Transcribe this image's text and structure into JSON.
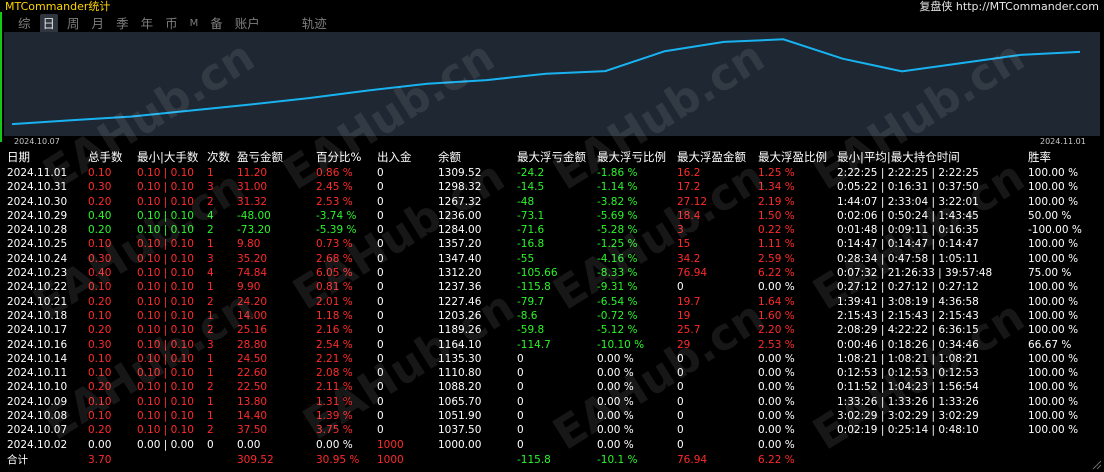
{
  "app": {
    "title": "MTCommander统计",
    "brand": "复盘侠 http://MTCommander.com"
  },
  "tabs": [
    "综",
    "日",
    "周",
    "月",
    "季",
    "年",
    "币",
    "M",
    "备",
    "账户",
    "轨迹"
  ],
  "active_tab": 1,
  "chart": {
    "start_label": "2024.10.07",
    "end_label": "2024.11.01",
    "line_color": "#19b2f0",
    "background": "#1e2732",
    "balance_series": [
      1037.5,
      1051.9,
      1065.7,
      1088.2,
      1110.8,
      1135.3,
      1164.1,
      1189.26,
      1203.26,
      1227.46,
      1237.36,
      1312.2,
      1347.4,
      1357.2,
      1284.0,
      1236.0,
      1267.32,
      1298.32,
      1309.52
    ]
  },
  "table": {
    "headers": [
      "日期",
      "总手数",
      "最小|大手数",
      "次数",
      "盈亏金额",
      "百分比%",
      "出入金",
      "余额",
      "最大浮亏金额",
      "最大浮亏比例",
      "最大浮盈金额",
      "最大浮盈比例",
      "最小|平均|最大持仓时间",
      "胜率"
    ],
    "rows": [
      {
        "date": "2024.11.01",
        "lots": "0.10",
        "minmax": "0.10 | 0.10",
        "count": "1",
        "pnl": "11.20",
        "pct": "0.86 %",
        "flow": "0",
        "balance": "1309.52",
        "max_loss": "-24.2",
        "max_loss_pct": "-1.86 %",
        "max_gain": "16.2",
        "max_gain_pct": "1.25 %",
        "hold": "2:22:25 | 2:22:25 | 2:22:25",
        "win": "100.00 %",
        "c": "red"
      },
      {
        "date": "2024.10.31",
        "lots": "0.30",
        "minmax": "0.10 | 0.10",
        "count": "3",
        "pnl": "31.00",
        "pct": "2.45 %",
        "flow": "0",
        "balance": "1298.32",
        "max_loss": "-14.5",
        "max_loss_pct": "-1.14 %",
        "max_gain": "17.2",
        "max_gain_pct": "1.34 %",
        "hold": "0:05:22 | 0:16:31 | 0:37:50",
        "win": "100.00 %",
        "c": "red"
      },
      {
        "date": "2024.10.30",
        "lots": "0.20",
        "minmax": "0.10 | 0.10",
        "count": "2",
        "pnl": "31.32",
        "pct": "2.53 %",
        "flow": "0",
        "balance": "1267.32",
        "max_loss": "-48",
        "max_loss_pct": "-3.82 %",
        "max_gain": "27.12",
        "max_gain_pct": "2.19 %",
        "hold": "1:44:07 | 2:33:04 | 3:22:01",
        "win": "100.00 %",
        "c": "red"
      },
      {
        "date": "2024.10.29",
        "lots": "0.40",
        "minmax": "0.10 | 0.10",
        "count": "4",
        "pnl": "-48.00",
        "pct": "-3.74 %",
        "flow": "0",
        "balance": "1236.00",
        "max_loss": "-73.1",
        "max_loss_pct": "-5.69 %",
        "max_gain": "18.4",
        "max_gain_pct": "1.50 %",
        "hold": "0:02:06 | 0:50:24 | 1:43:45",
        "win": "50.00 %",
        "c": "green"
      },
      {
        "date": "2024.10.28",
        "lots": "0.20",
        "minmax": "0.10 | 0.10",
        "count": "2",
        "pnl": "-73.20",
        "pct": "-5.39 %",
        "flow": "0",
        "balance": "1284.00",
        "max_loss": "-71.6",
        "max_loss_pct": "-5.28 %",
        "max_gain": "3",
        "max_gain_pct": "0.22 %",
        "hold": "0:01:48 | 0:09:11 | 0:16:35",
        "win": "-100.00 %",
        "c": "green"
      },
      {
        "date": "2024.10.25",
        "lots": "0.10",
        "minmax": "0.10 | 0.10",
        "count": "1",
        "pnl": "9.80",
        "pct": "0.73 %",
        "flow": "0",
        "balance": "1357.20",
        "max_loss": "-16.8",
        "max_loss_pct": "-1.25 %",
        "max_gain": "15",
        "max_gain_pct": "1.11 %",
        "hold": "0:14:47 | 0:14:47 | 0:14:47",
        "win": "100.00 %",
        "c": "red"
      },
      {
        "date": "2024.10.24",
        "lots": "0.30",
        "minmax": "0.10 | 0.10",
        "count": "3",
        "pnl": "35.20",
        "pct": "2.68 %",
        "flow": "0",
        "balance": "1347.40",
        "max_loss": "-55",
        "max_loss_pct": "-4.16 %",
        "max_gain": "34.2",
        "max_gain_pct": "2.59 %",
        "hold": "0:28:34 | 0:47:58 | 1:05:11",
        "win": "100.00 %",
        "c": "red"
      },
      {
        "date": "2024.10.23",
        "lots": "0.40",
        "minmax": "0.10 | 0.10",
        "count": "4",
        "pnl": "74.84",
        "pct": "6.05 %",
        "flow": "0",
        "balance": "1312.20",
        "max_loss": "-105.66",
        "max_loss_pct": "-8.33 %",
        "max_gain": "76.94",
        "max_gain_pct": "6.22 %",
        "hold": "0:07:32 | 21:26:33 | 39:57:48",
        "win": "75.00 %",
        "c": "red"
      },
      {
        "date": "2024.10.22",
        "lots": "0.10",
        "minmax": "0.10 | 0.10",
        "count": "1",
        "pnl": "9.90",
        "pct": "0.81 %",
        "flow": "0",
        "balance": "1237.36",
        "max_loss": "-115.8",
        "max_loss_pct": "-9.31 %",
        "max_gain": "0",
        "max_gain_pct": "0.00 %",
        "hold": "0:27:12 | 0:27:12 | 0:27:12",
        "win": "100.00 %",
        "c": "red"
      },
      {
        "date": "2024.10.21",
        "lots": "0.20",
        "minmax": "0.10 | 0.10",
        "count": "2",
        "pnl": "24.20",
        "pct": "2.01 %",
        "flow": "0",
        "balance": "1227.46",
        "max_loss": "-79.7",
        "max_loss_pct": "-6.54 %",
        "max_gain": "19.7",
        "max_gain_pct": "1.64 %",
        "hold": "1:39:41 | 3:08:19 | 4:36:58",
        "win": "100.00 %",
        "c": "red"
      },
      {
        "date": "2024.10.18",
        "lots": "0.10",
        "minmax": "0.10 | 0.10",
        "count": "1",
        "pnl": "14.00",
        "pct": "1.18 %",
        "flow": "0",
        "balance": "1203.26",
        "max_loss": "-8.6",
        "max_loss_pct": "-0.72 %",
        "max_gain": "19",
        "max_gain_pct": "1.60 %",
        "hold": "2:15:43 | 2:15:43 | 2:15:43",
        "win": "100.00 %",
        "c": "red"
      },
      {
        "date": "2024.10.17",
        "lots": "0.20",
        "minmax": "0.10 | 0.10",
        "count": "2",
        "pnl": "25.16",
        "pct": "2.16 %",
        "flow": "0",
        "balance": "1189.26",
        "max_loss": "-59.8",
        "max_loss_pct": "-5.12 %",
        "max_gain": "25.7",
        "max_gain_pct": "2.20 %",
        "hold": "2:08:29 | 4:22:22 | 6:36:15",
        "win": "100.00 %",
        "c": "red"
      },
      {
        "date": "2024.10.16",
        "lots": "0.30",
        "minmax": "0.10 | 0.10",
        "count": "3",
        "pnl": "28.80",
        "pct": "2.54 %",
        "flow": "0",
        "balance": "1164.10",
        "max_loss": "-114.7",
        "max_loss_pct": "-10.10 %",
        "max_gain": "29",
        "max_gain_pct": "2.53 %",
        "hold": "0:00:46 | 0:18:26 | 0:34:46",
        "win": "66.67 %",
        "c": "red"
      },
      {
        "date": "2024.10.14",
        "lots": "0.10",
        "minmax": "0.10 | 0.10",
        "count": "1",
        "pnl": "24.50",
        "pct": "2.21 %",
        "flow": "0",
        "balance": "1135.30",
        "max_loss": "0",
        "max_loss_pct": "0.00 %",
        "max_gain": "0",
        "max_gain_pct": "0.00 %",
        "hold": "1:08:21 | 1:08:21 | 1:08:21",
        "win": "100.00 %",
        "c": "red"
      },
      {
        "date": "2024.10.11",
        "lots": "0.10",
        "minmax": "0.10 | 0.10",
        "count": "1",
        "pnl": "22.60",
        "pct": "2.08 %",
        "flow": "0",
        "balance": "1110.80",
        "max_loss": "0",
        "max_loss_pct": "0.00 %",
        "max_gain": "0",
        "max_gain_pct": "0.00 %",
        "hold": "0:12:53 | 0:12:53 | 0:12:53",
        "win": "100.00 %",
        "c": "red"
      },
      {
        "date": "2024.10.10",
        "lots": "0.20",
        "minmax": "0.10 | 0.10",
        "count": "2",
        "pnl": "22.50",
        "pct": "2.11 %",
        "flow": "0",
        "balance": "1088.20",
        "max_loss": "0",
        "max_loss_pct": "0.00 %",
        "max_gain": "0",
        "max_gain_pct": "0.00 %",
        "hold": "0:11:52 | 1:04:23 | 1:56:54",
        "win": "100.00 %",
        "c": "red"
      },
      {
        "date": "2024.10.09",
        "lots": "0.10",
        "minmax": "0.10 | 0.10",
        "count": "1",
        "pnl": "13.80",
        "pct": "1.31 %",
        "flow": "0",
        "balance": "1065.70",
        "max_loss": "0",
        "max_loss_pct": "0.00 %",
        "max_gain": "0",
        "max_gain_pct": "0.00 %",
        "hold": "1:33:26 | 1:33:26 | 1:33:26",
        "win": "100.00 %",
        "c": "red"
      },
      {
        "date": "2024.10.08",
        "lots": "0.10",
        "minmax": "0.10 | 0.10",
        "count": "1",
        "pnl": "14.40",
        "pct": "1.39 %",
        "flow": "0",
        "balance": "1051.90",
        "max_loss": "0",
        "max_loss_pct": "0.00 %",
        "max_gain": "0",
        "max_gain_pct": "0.00 %",
        "hold": "3:02:29 | 3:02:29 | 3:02:29",
        "win": "100.00 %",
        "c": "red"
      },
      {
        "date": "2024.10.07",
        "lots": "0.20",
        "minmax": "0.10 | 0.10",
        "count": "2",
        "pnl": "37.50",
        "pct": "3.75 %",
        "flow": "0",
        "balance": "1037.50",
        "max_loss": "0",
        "max_loss_pct": "0.00 %",
        "max_gain": "0",
        "max_gain_pct": "0.00 %",
        "hold": "0:02:19 | 0:25:14 | 0:48:10",
        "win": "100.00 %",
        "c": "red"
      },
      {
        "date": "2024.10.02",
        "lots": "0.00",
        "minmax": "0.00 | 0.00",
        "count": "0",
        "pnl": "0.00",
        "pct": "0.00 %",
        "flow": "1000",
        "balance": "1000.00",
        "max_loss": "0",
        "max_loss_pct": "0.00 %",
        "max_gain": "0",
        "max_gain_pct": "0.00 %",
        "hold": "",
        "win": "",
        "c": "white"
      }
    ],
    "summary": {
      "date": "合计",
      "lots": "3.70",
      "pnl": "309.52",
      "pct": "30.95 %",
      "flow": "1000",
      "max_loss": "-115.8",
      "max_loss_pct": "-10.1 %",
      "max_gain": "76.94",
      "max_gain_pct": "6.22 %"
    }
  },
  "watermark": "EAHub.cn"
}
